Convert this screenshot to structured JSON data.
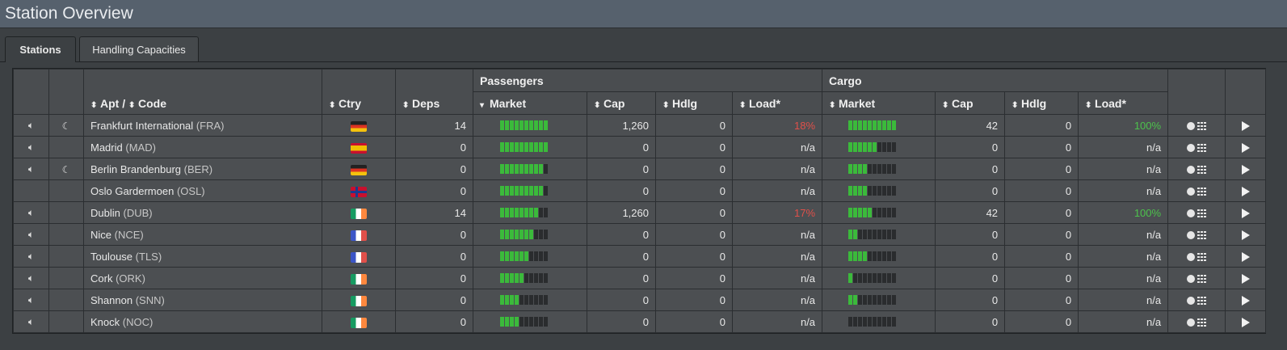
{
  "window": {
    "title": "Station Overview"
  },
  "tabs": [
    {
      "label": "Stations",
      "active": true
    },
    {
      "label": "Handling Capacities",
      "active": false
    }
  ],
  "headers": {
    "passengers": "Passengers",
    "cargo": "Cargo",
    "apt": "Apt",
    "slash": "/",
    "code": "Code",
    "ctry": "Ctry",
    "deps": "Deps",
    "market": "Market",
    "cap": "Cap",
    "hdlg": "Hdlg",
    "load": "Load*"
  },
  "colors": {
    "red": "#e0504a",
    "green": "#4cc24c",
    "bar_on": "#3bba3b"
  },
  "rows": [
    {
      "sound": true,
      "night": true,
      "name": "Frankfurt International",
      "code": "(FRA)",
      "flag": "de",
      "deps": "14",
      "pax_market": 10,
      "pax_cap": "1,260",
      "pax_hdlg": "0",
      "pax_load": "18%",
      "pax_load_color": "red",
      "cargo_market": 10,
      "cargo_cap": "42",
      "cargo_hdlg": "0",
      "cargo_load": "100%",
      "cargo_load_color": "green"
    },
    {
      "sound": true,
      "night": false,
      "name": "Madrid",
      "code": "(MAD)",
      "flag": "es",
      "deps": "0",
      "pax_market": 10,
      "pax_cap": "0",
      "pax_hdlg": "0",
      "pax_load": "n/a",
      "pax_load_color": "",
      "cargo_market": 6,
      "cargo_cap": "0",
      "cargo_hdlg": "0",
      "cargo_load": "n/a",
      "cargo_load_color": ""
    },
    {
      "sound": true,
      "night": true,
      "name": "Berlin Brandenburg",
      "code": "(BER)",
      "flag": "de",
      "deps": "0",
      "pax_market": 9,
      "pax_cap": "0",
      "pax_hdlg": "0",
      "pax_load": "n/a",
      "pax_load_color": "",
      "cargo_market": 4,
      "cargo_cap": "0",
      "cargo_hdlg": "0",
      "cargo_load": "n/a",
      "cargo_load_color": ""
    },
    {
      "sound": false,
      "night": false,
      "name": "Oslo Gardermoen",
      "code": "(OSL)",
      "flag": "no",
      "deps": "0",
      "pax_market": 9,
      "pax_cap": "0",
      "pax_hdlg": "0",
      "pax_load": "n/a",
      "pax_load_color": "",
      "cargo_market": 4,
      "cargo_cap": "0",
      "cargo_hdlg": "0",
      "cargo_load": "n/a",
      "cargo_load_color": ""
    },
    {
      "sound": true,
      "night": false,
      "name": "Dublin",
      "code": "(DUB)",
      "flag": "ie",
      "deps": "14",
      "pax_market": 8,
      "pax_cap": "1,260",
      "pax_hdlg": "0",
      "pax_load": "17%",
      "pax_load_color": "red",
      "cargo_market": 5,
      "cargo_cap": "42",
      "cargo_hdlg": "0",
      "cargo_load": "100%",
      "cargo_load_color": "green"
    },
    {
      "sound": true,
      "night": false,
      "name": "Nice",
      "code": "(NCE)",
      "flag": "fr",
      "deps": "0",
      "pax_market": 7,
      "pax_cap": "0",
      "pax_hdlg": "0",
      "pax_load": "n/a",
      "pax_load_color": "",
      "cargo_market": 2,
      "cargo_cap": "0",
      "cargo_hdlg": "0",
      "cargo_load": "n/a",
      "cargo_load_color": ""
    },
    {
      "sound": true,
      "night": false,
      "name": "Toulouse",
      "code": "(TLS)",
      "flag": "fr",
      "deps": "0",
      "pax_market": 6,
      "pax_cap": "0",
      "pax_hdlg": "0",
      "pax_load": "n/a",
      "pax_load_color": "",
      "cargo_market": 4,
      "cargo_cap": "0",
      "cargo_hdlg": "0",
      "cargo_load": "n/a",
      "cargo_load_color": ""
    },
    {
      "sound": true,
      "night": false,
      "name": "Cork",
      "code": "(ORK)",
      "flag": "ie",
      "deps": "0",
      "pax_market": 5,
      "pax_cap": "0",
      "pax_hdlg": "0",
      "pax_load": "n/a",
      "pax_load_color": "",
      "cargo_market": 1,
      "cargo_cap": "0",
      "cargo_hdlg": "0",
      "cargo_load": "n/a",
      "cargo_load_color": ""
    },
    {
      "sound": true,
      "night": false,
      "name": "Shannon",
      "code": "(SNN)",
      "flag": "ie",
      "deps": "0",
      "pax_market": 4,
      "pax_cap": "0",
      "pax_hdlg": "0",
      "pax_load": "n/a",
      "pax_load_color": "",
      "cargo_market": 2,
      "cargo_cap": "0",
      "cargo_hdlg": "0",
      "cargo_load": "n/a",
      "cargo_load_color": ""
    },
    {
      "sound": true,
      "night": false,
      "name": "Knock",
      "code": "(NOC)",
      "flag": "ie",
      "deps": "0",
      "pax_market": 4,
      "pax_cap": "0",
      "pax_hdlg": "0",
      "pax_load": "n/a",
      "pax_load_color": "",
      "cargo_market": 0,
      "cargo_cap": "0",
      "cargo_hdlg": "0",
      "cargo_load": "n/a",
      "cargo_load_color": ""
    }
  ],
  "bar_total": 10
}
